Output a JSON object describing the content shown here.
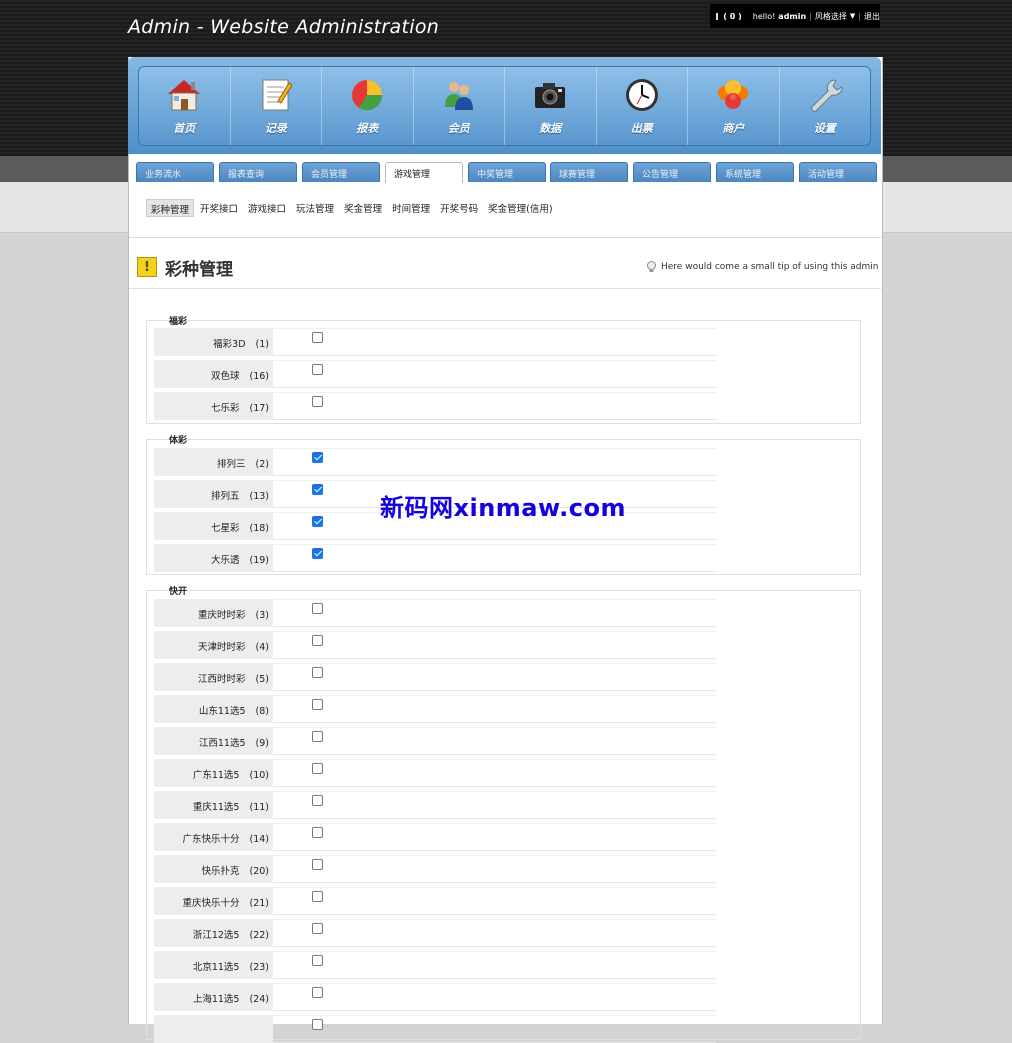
{
  "header": {
    "title": "Admin - Website Administration",
    "user_bar": {
      "mail_count": "( 0 )",
      "greeting": "hello!",
      "username": "admin",
      "style_select": "风格选择",
      "logout": "退出"
    }
  },
  "main_nav": [
    {
      "label": "首页",
      "icon": "home-icon"
    },
    {
      "label": "记录",
      "icon": "notepad-icon"
    },
    {
      "label": "报表",
      "icon": "pie-chart-icon"
    },
    {
      "label": "会员",
      "icon": "users-icon"
    },
    {
      "label": "数据",
      "icon": "camera-icon"
    },
    {
      "label": "出票",
      "icon": "clock-icon"
    },
    {
      "label": "商户",
      "icon": "merchant-icon"
    },
    {
      "label": "设置",
      "icon": "wrench-icon"
    }
  ],
  "tabs": [
    {
      "label": "业务流水",
      "active": false
    },
    {
      "label": "报表查询",
      "active": false
    },
    {
      "label": "会员管理",
      "active": false
    },
    {
      "label": "游戏管理",
      "active": true
    },
    {
      "label": "中奖管理",
      "active": false
    },
    {
      "label": "球赛管理",
      "active": false
    },
    {
      "label": "公告管理",
      "active": false
    },
    {
      "label": "系统管理",
      "active": false
    },
    {
      "label": "活动管理",
      "active": false
    }
  ],
  "subnav": [
    {
      "label": "彩种管理",
      "active": true
    },
    {
      "label": "开奖接口",
      "active": false
    },
    {
      "label": "游戏接口",
      "active": false
    },
    {
      "label": "玩法管理",
      "active": false
    },
    {
      "label": "奖金管理",
      "active": false
    },
    {
      "label": "时间管理",
      "active": false
    },
    {
      "label": "开奖号码",
      "active": false
    },
    {
      "label": "奖金管理(信用)",
      "active": false
    }
  ],
  "page": {
    "title": "彩种管理",
    "tip": "Here would come a small tip of using this admin"
  },
  "groups": [
    {
      "title": "福彩",
      "items": [
        {
          "name": "福彩3D",
          "id": "(1)",
          "checked": false
        },
        {
          "name": "双色球",
          "id": "(16)",
          "checked": false
        },
        {
          "name": "七乐彩",
          "id": "(17)",
          "checked": false
        }
      ]
    },
    {
      "title": "体彩",
      "items": [
        {
          "name": "排列三",
          "id": "(2)",
          "checked": true
        },
        {
          "name": "排列五",
          "id": "(13)",
          "checked": true
        },
        {
          "name": "七星彩",
          "id": "(18)",
          "checked": true
        },
        {
          "name": "大乐透",
          "id": "(19)",
          "checked": true
        }
      ]
    },
    {
      "title": "快开",
      "items": [
        {
          "name": "重庆时时彩",
          "id": "(3)",
          "checked": false
        },
        {
          "name": "天津时时彩",
          "id": "(4)",
          "checked": false
        },
        {
          "name": "江西时时彩",
          "id": "(5)",
          "checked": false
        },
        {
          "name": "山东11选5",
          "id": "(8)",
          "checked": false
        },
        {
          "name": "江西11选5",
          "id": "(9)",
          "checked": false
        },
        {
          "name": "广东11选5",
          "id": "(10)",
          "checked": false
        },
        {
          "name": "重庆11选5",
          "id": "(11)",
          "checked": false
        },
        {
          "name": "广东快乐十分",
          "id": "(14)",
          "checked": false
        },
        {
          "name": "快乐扑克",
          "id": "(20)",
          "checked": false
        },
        {
          "name": "重庆快乐十分",
          "id": "(21)",
          "checked": false
        },
        {
          "name": "浙江12选5",
          "id": "(22)",
          "checked": false
        },
        {
          "name": "北京11选5",
          "id": "(23)",
          "checked": false
        },
        {
          "name": "上海11选5",
          "id": "(24)",
          "checked": false
        },
        {
          "name": "",
          "id": "",
          "checked": false
        }
      ]
    }
  ],
  "watermark": "新码网xinmaw.com"
}
